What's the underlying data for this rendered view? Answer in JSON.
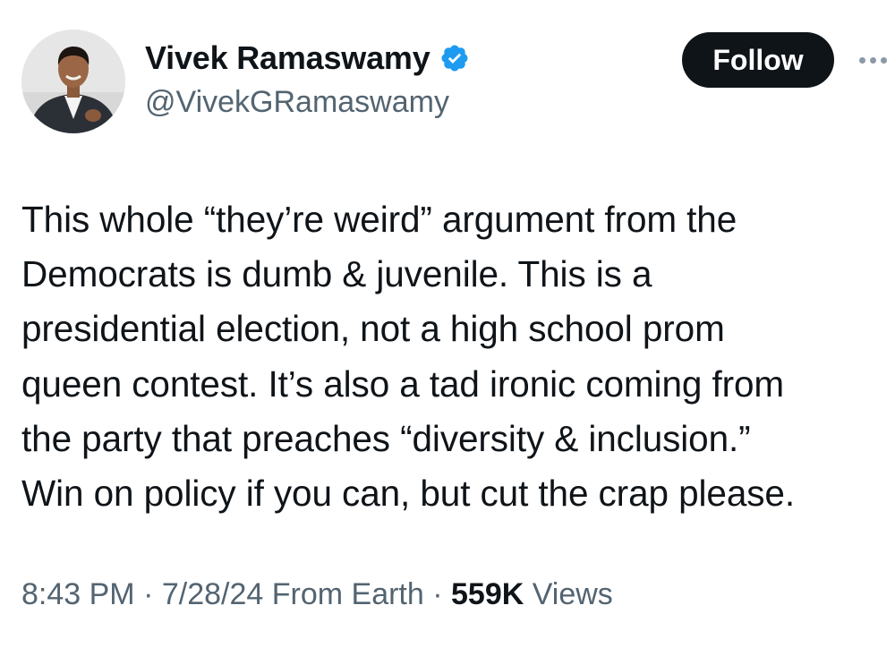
{
  "author": {
    "display_name": "Vivek Ramaswamy",
    "handle": "@VivekGRamaswamy",
    "verified_icon": "verified-badge-icon",
    "avatar_icon": "profile-photo"
  },
  "actions": {
    "follow_label": "Follow",
    "more_icon": "more-options-icon"
  },
  "tweet": {
    "lines": [
      "This whole “they’re weird” argument from the",
      "Democrats is dumb & juvenile. This is a",
      "presidential election, not a high school prom",
      "queen contest. It’s also a tad ironic coming from",
      "the party that preaches “diversity & inclusion.”",
      "Win on policy if you can, but cut the crap please."
    ]
  },
  "meta": {
    "time": "8:43 PM",
    "sep1": " · ",
    "date": "7/28/24",
    "source": " From Earth",
    "sep2": " · ",
    "views_count": "559K",
    "views_label": " Views"
  },
  "colors": {
    "text": "#0f1419",
    "secondary": "#536471",
    "verified_blue": "#1d9bf0",
    "button_bg": "#0f1419"
  }
}
